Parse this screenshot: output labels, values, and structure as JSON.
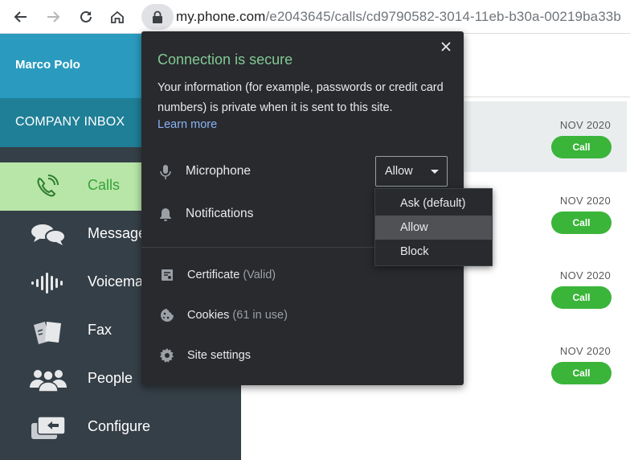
{
  "browser": {
    "url_host": "my.phone.com",
    "url_path": "/e2043645/calls/cd9790582-3014-11eb-b30a-00219ba33b"
  },
  "sidebar": {
    "user_name": "Marco Polo",
    "inbox_label": "COMPANY INBOX",
    "items": [
      {
        "label": "Calls",
        "icon": "phone-call-icon",
        "active": true
      },
      {
        "label": "Messages",
        "icon": "chat-bubbles-icon",
        "active": false
      },
      {
        "label": "Voicemail",
        "icon": "voice-wave-icon",
        "active": false
      },
      {
        "label": "Fax",
        "icon": "fax-icon",
        "active": false
      },
      {
        "label": "People",
        "icon": "people-icon",
        "active": false
      },
      {
        "label": "Configure",
        "icon": "configure-icon",
        "active": false
      }
    ],
    "colors": {
      "user_bg": "#2a9bbf",
      "inbox_bg": "#1f7f96",
      "nav_bg": "#353f47",
      "active_bg": "#b8e6a8",
      "active_text": "#36a13a"
    }
  },
  "calls": [
    {
      "date": "NOV 2020",
      "action": "Call",
      "highlighted": true
    },
    {
      "date": "NOV 2020",
      "action": "Call",
      "highlighted": false
    },
    {
      "date": "NOV 2020",
      "action": "Call",
      "highlighted": false
    },
    {
      "date": "NOV 2020",
      "action": "Call",
      "highlighted": false
    }
  ],
  "popup": {
    "title": "Connection is secure",
    "description": "Your information (for example, passwords or credit card numbers) is private when it is sent to this site.",
    "learn_more": "Learn more",
    "permissions": [
      {
        "label": "Microphone",
        "icon": "microphone-icon",
        "value": "Allow"
      },
      {
        "label": "Notifications",
        "icon": "bell-icon"
      }
    ],
    "links": [
      {
        "label": "Certificate",
        "sub": "(Valid)",
        "icon": "certificate-icon"
      },
      {
        "label": "Cookies",
        "sub": "(61 in use)",
        "icon": "cookie-icon"
      },
      {
        "label": "Site settings",
        "sub": "",
        "icon": "gear-icon"
      }
    ],
    "colors": {
      "bg": "#292a2d",
      "title": "#81c995",
      "link": "#8ab4f8"
    }
  },
  "dropdown": {
    "options": [
      "Ask (default)",
      "Allow",
      "Block"
    ],
    "selected": "Allow"
  }
}
